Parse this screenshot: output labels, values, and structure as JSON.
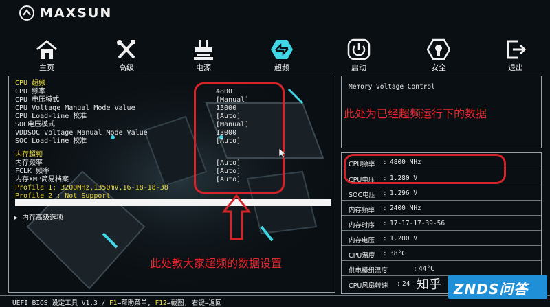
{
  "brand": {
    "name": "MAXSUN"
  },
  "nav": [
    {
      "label": "主页",
      "icon": "home-icon"
    },
    {
      "label": "高级",
      "icon": "tools-icon"
    },
    {
      "label": "电源",
      "icon": "power-plug-icon"
    },
    {
      "label": "超频",
      "icon": "overclock-icon"
    },
    {
      "label": "启动",
      "icon": "power-icon"
    },
    {
      "label": "安全",
      "icon": "shield-icon"
    },
    {
      "label": "退出",
      "icon": "exit-icon"
    }
  ],
  "settings": {
    "cpu_oc_header": "CPU 超频",
    "cpu_freq": {
      "label": "CPU 频率",
      "value": "4800"
    },
    "cpu_vmode": {
      "label": "CPU 电压模式",
      "value": "[Manual]"
    },
    "cpu_vmanual": {
      "label": "CPU Voltage Manual Mode Value",
      "value": "13000"
    },
    "cpu_loadline": {
      "label": "CPU Load-line 校准",
      "value": "[Auto]"
    },
    "soc_vmode": {
      "label": "SOC电压模式",
      "value": "[Manual]"
    },
    "vddsoc": {
      "label": "VDDSOC Voltage Manual Mode Value",
      "value": "13000"
    },
    "soc_loadline": {
      "label": "SOC Load-line 校准",
      "value": "[Auto]"
    },
    "mem_oc_header": "内存超频",
    "mem_freq": {
      "label": "内存频率",
      "value": "[Auto]"
    },
    "fclk": {
      "label": "FCLK 频率",
      "value": "[Auto]"
    },
    "xmp": {
      "label": "内存XMP简易档案",
      "value": "[Auto]"
    },
    "profile1": "Profile 1: 3200MHz,1350mV,16-18-18-38",
    "profile2": "Profile 2 : Not Support",
    "mem_advanced": "内存高级选项"
  },
  "help": {
    "title": "Memory Voltage Control"
  },
  "status": [
    {
      "label": "CPU频率",
      "value": "4800 MHz"
    },
    {
      "label": "CPU电压",
      "value": "1.280 V"
    },
    {
      "label": "SOC电压",
      "value": "1.296 V"
    },
    {
      "label": "内存频率",
      "value": "2400 MHz"
    },
    {
      "label": "内存时序",
      "value": "17-17-17-39-56"
    },
    {
      "label": "内存电压",
      "value": "1.200 V"
    },
    {
      "label": "CPU温度",
      "value": "38°C"
    },
    {
      "label": "供电模组温度",
      "value": "44°C"
    },
    {
      "label": "CPU风扇转速",
      "value": "24"
    }
  ],
  "annotations": {
    "top": "此处为已经超频运行下的数据",
    "bottom": "此处教大家超频的数据设置"
  },
  "footer": {
    "tool": "UEFI BIOS 设定工具 V1.3 / ",
    "f1_key": "F1",
    "f1_text": "→帮助菜单, ",
    "f12_key": "F12",
    "f12_text": "→截图, 右键→返回"
  },
  "watermarks": {
    "zhihu": "知乎",
    "znds": "ZNDS问答"
  },
  "colors": {
    "accent_yellow": "#f0e040",
    "annotation_red": "#d6232a",
    "watermark_blue": "#1f8fd8"
  }
}
